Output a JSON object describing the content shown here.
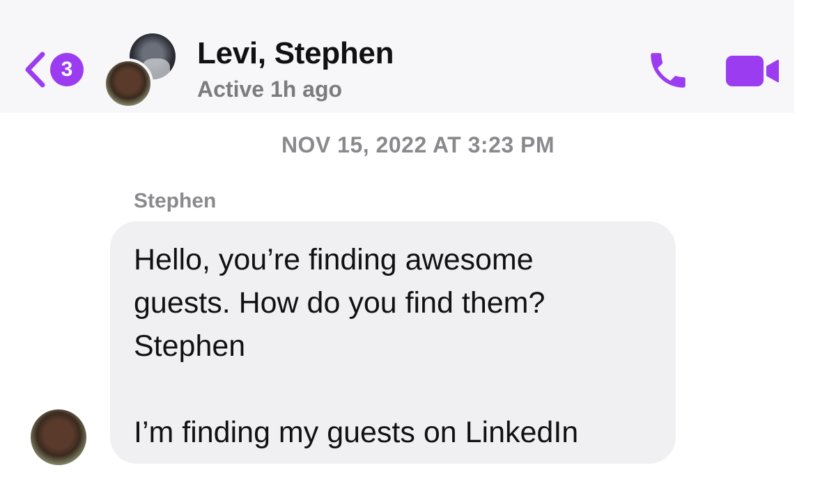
{
  "header": {
    "back_badge_count": "3",
    "title": "Levi, Stephen",
    "status": "Active 1h ago",
    "icons": {
      "back": "chevron-left-icon",
      "call": "phone-icon",
      "video": "video-camera-icon"
    }
  },
  "conversation": {
    "timestamp": "NOV 15, 2022 AT 3:23 PM",
    "messages": [
      {
        "sender": "Stephen",
        "lines": [
          "Hello, you’re finding awesome",
          "guests. How do you find them?",
          "Stephen",
          "",
          "I’m finding my guests on LinkedIn"
        ]
      }
    ]
  },
  "colors": {
    "accent": "#9b3cf0",
    "header_background": "#f7f6f9",
    "bubble_background": "#f0f0f2",
    "secondary_text": "#8a8a8e"
  }
}
